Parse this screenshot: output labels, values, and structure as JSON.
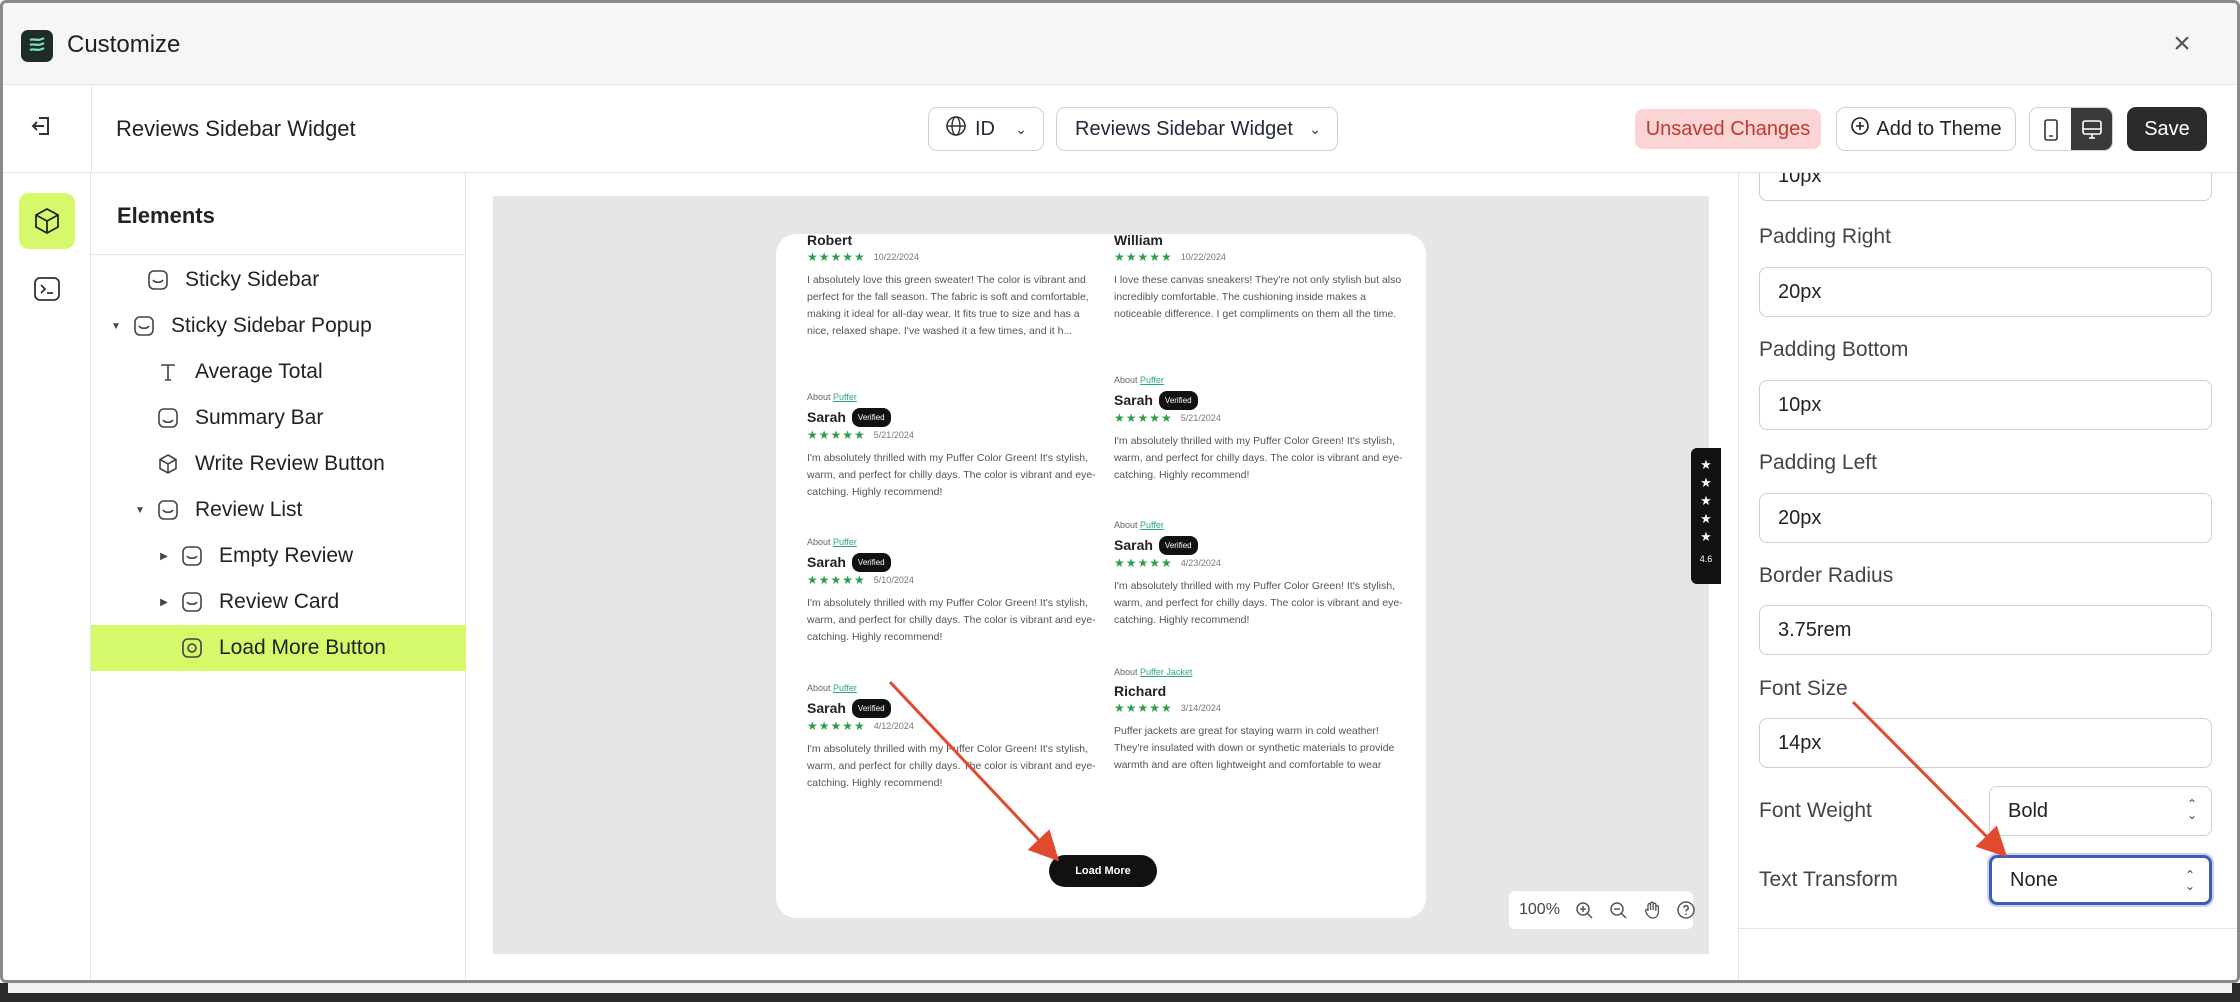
{
  "window": {
    "title": "Customize"
  },
  "header": {
    "title": "Reviews Sidebar Widget",
    "language": "ID",
    "widget_select": "Reviews Sidebar Widget",
    "unsaved": "Unsaved Changes",
    "add_to_theme": "Add to Theme",
    "save": "Save"
  },
  "elements": {
    "heading": "Elements",
    "items": [
      {
        "label": "Sticky Sidebar"
      },
      {
        "label": "Sticky Sidebar Popup"
      },
      {
        "label": "Average Total"
      },
      {
        "label": "Summary Bar"
      },
      {
        "label": "Write Review Button"
      },
      {
        "label": "Review List"
      },
      {
        "label": "Empty Review"
      },
      {
        "label": "Review Card"
      },
      {
        "label": "Load More Button"
      }
    ]
  },
  "preview": {
    "reviews": [
      {
        "name": "Robert",
        "date": "10/22/2024",
        "body": "I absolutely love this green sweater! The color is vibrant and perfect for the fall season. The fabric is soft and comfortable, making it ideal for all-day wear. It fits true to size and has a nice, relaxed shape. I've washed it a few times, and it h..."
      },
      {
        "name": "William",
        "date": "10/22/2024",
        "body": "I love these canvas sneakers! They're not only stylish but also incredibly comfortable. The cushioning inside makes a noticeable difference. I get compliments on them all the time."
      },
      {
        "about": "About",
        "product": "Puffer",
        "name": "Sarah",
        "badge": "Verified",
        "date": "5/21/2024",
        "body": "I'm absolutely thrilled with my Puffer Color Green! It's stylish, warm, and perfect for chilly days. The color is vibrant and eye-catching. Highly recommend!"
      },
      {
        "about": "About",
        "product": "Puffer",
        "name": "Sarah",
        "badge": "Verified",
        "date": "5/21/2024",
        "body": "I'm absolutely thrilled with my Puffer Color Green! It's stylish, warm, and perfect for chilly days. The color is vibrant and eye-catching. Highly recommend!"
      },
      {
        "about": "About",
        "product": "Puffer",
        "name": "Sarah",
        "badge": "Verified",
        "date": "5/10/2024",
        "body": "I'm absolutely thrilled with my Puffer Color Green! It's stylish, warm, and perfect for chilly days. The color is vibrant and eye-catching. Highly recommend!"
      },
      {
        "about": "About",
        "product": "Puffer",
        "name": "Sarah",
        "badge": "Verified",
        "date": "4/23/2024",
        "body": "I'm absolutely thrilled with my Puffer Color Green! It's stylish, warm, and perfect for chilly days. The color is vibrant and eye-catching. Highly recommend!"
      },
      {
        "about": "About",
        "product": "Puffer",
        "name": "Sarah",
        "badge": "Verified",
        "date": "4/12/2024",
        "body": "I'm absolutely thrilled with my Puffer Color Green! It's stylish, warm, and perfect for chilly days. The color is vibrant and eye-catching. Highly recommend!"
      },
      {
        "about": "About",
        "product": "Puffer Jacket",
        "name": "Richard",
        "date": "3/14/2024",
        "body": "Puffer jackets are great for staying warm in cold weather! They're insulated with down or synthetic materials to provide warmth and are often lightweight and comfortable to wear"
      }
    ],
    "stars": "★★★★★",
    "load_more": "Load More",
    "rating_tab": {
      "stars": "★",
      "value": "4.6"
    },
    "zoom": "100%"
  },
  "settings": {
    "top_partial_value": "10px",
    "padding_right": {
      "label": "Padding Right",
      "value": "20px"
    },
    "padding_bottom": {
      "label": "Padding Bottom",
      "value": "10px"
    },
    "padding_left": {
      "label": "Padding Left",
      "value": "20px"
    },
    "border_radius": {
      "label": "Border Radius",
      "value": "3.75rem"
    },
    "font_size": {
      "label": "Font Size",
      "value": "14px"
    },
    "font_weight": {
      "label": "Font Weight",
      "value": "Bold"
    },
    "text_transform": {
      "label": "Text Transform",
      "value": "None"
    }
  },
  "colors": {
    "accent": "#d6f96b",
    "unsaved_bg": "#fbd5d5",
    "unsaved_text": "#c0392b",
    "save_bg": "#2b2b2b",
    "star_green": "#2e9e4a",
    "annotation_red": "#e04a2f",
    "focus_ring": "#3f5bb6"
  }
}
